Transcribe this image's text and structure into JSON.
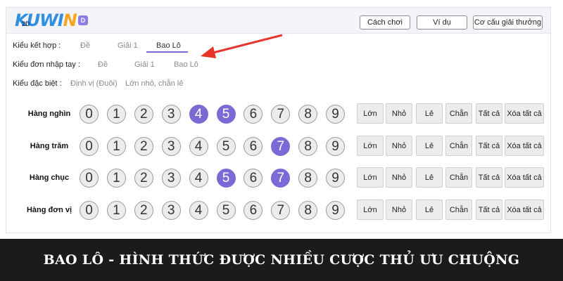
{
  "logo": {
    "text_part1": "KUWI",
    "text_part2": "N",
    "badge": "2D",
    "tag": "D"
  },
  "header": {
    "buttons": [
      {
        "label": "Cách chơi"
      },
      {
        "label": "Ví dụ"
      },
      {
        "label": "Cơ cấu giải thưởng"
      }
    ]
  },
  "options": {
    "ket_hop": {
      "label": "Kiểu kết hợp :",
      "items": [
        "Đề",
        "Giải 1",
        "Bao Lô"
      ],
      "active": "Bao Lô"
    },
    "nhap_tay": {
      "label": "Kiểu đơn nhập tay :",
      "items": [
        "Đề",
        "Giải 1",
        "Bao Lô"
      ]
    },
    "dac_biet": {
      "label": "Kiểu đặc biệt :",
      "items": [
        "Định vị (Đuôi)",
        "Lớn nhỏ, chẵn lẻ"
      ]
    }
  },
  "digits": [
    "0",
    "1",
    "2",
    "3",
    "4",
    "5",
    "6",
    "7",
    "8",
    "9"
  ],
  "rows": [
    {
      "label": "Hàng nghìn",
      "selected": [
        4,
        5
      ]
    },
    {
      "label": "Hàng trăm",
      "selected": [
        7
      ]
    },
    {
      "label": "Hàng chục",
      "selected": [
        5,
        7
      ]
    },
    {
      "label": "Hàng đơn vị",
      "selected": []
    }
  ],
  "quick_buttons": [
    "Lớn",
    "Nhỏ",
    "Lẻ",
    "Chẵn",
    "Tất cả",
    "Xóa tất cả"
  ],
  "colors": {
    "accent": "#7b6ad6",
    "arrow": "#e8352a",
    "banner_bg": "#1b1b1b"
  },
  "banner": {
    "text": "BAO LÔ - HÌNH THỨC ĐƯỢC NHIỀU CƯỢC THỦ ƯU CHUỘNG"
  }
}
